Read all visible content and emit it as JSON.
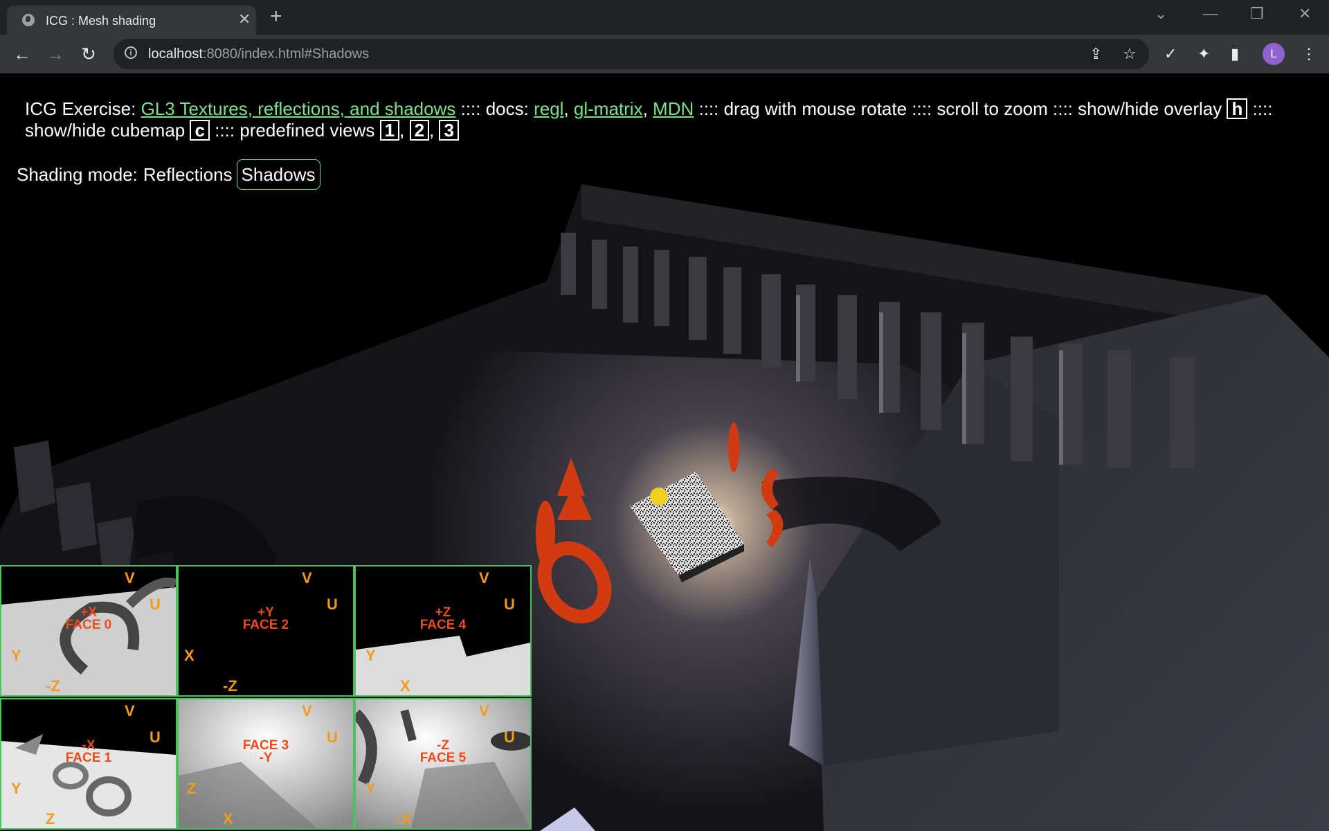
{
  "browser": {
    "tab_title": "ICG : Mesh shading",
    "url_host": "localhost",
    "url_rest": ":8080/index.html#Shadows",
    "avatar_letter": "L"
  },
  "overlay": {
    "prefix": "ICG Exercise: ",
    "exercise_link": "GL3 Textures, reflections, and shadows",
    "docs_text": " :::: docs: ",
    "doc_links": [
      "regl",
      "gl-matrix",
      "MDN"
    ],
    "after_docs": " :::: drag with mouse rotate :::: scroll to zoom :::: show/hide overlay ",
    "key_overlay": "h",
    "after_overlay": " :::: show/hide cubemap ",
    "key_cubemap": "c",
    "after_cubemap": " :::: predefined views ",
    "view_keys": [
      "1",
      "2",
      "3"
    ]
  },
  "shading": {
    "label": "Shading mode:",
    "modes": [
      "Reflections",
      "Shadows"
    ],
    "active": "Shadows"
  },
  "cubemap": {
    "faces": [
      {
        "sign": "+X",
        "face": "FACE 0",
        "u": "U",
        "v": "V",
        "x": "-Z",
        "y": "Y"
      },
      {
        "sign": "+Y",
        "face": "FACE 2",
        "u": "U",
        "v": "V",
        "x": "X",
        "y": "-Z"
      },
      {
        "sign": "+Z",
        "face": "FACE 4",
        "u": "U",
        "v": "V",
        "x": "X",
        "y": "Y"
      },
      {
        "sign": "-X",
        "face": "FACE 1",
        "u": "U",
        "v": "V",
        "x": "Z",
        "y": "Y"
      },
      {
        "sign": "-Y",
        "face": "FACE 3",
        "u": "U",
        "v": "V",
        "x": "X",
        "y": "Z"
      },
      {
        "sign": "-Z",
        "face": "FACE 5",
        "u": "U",
        "v": "V",
        "x": "-X",
        "y": "Y"
      }
    ]
  },
  "colors": {
    "link": "#7ee08a",
    "face_border": "#4fc15b",
    "face_label": "#ef4a1a",
    "axis": "#f29a1a",
    "object_red": "#d23b12"
  }
}
